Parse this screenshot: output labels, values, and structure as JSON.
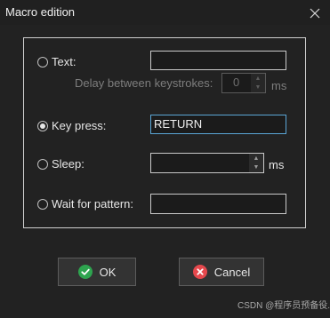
{
  "window": {
    "title": "Macro edition",
    "close_glyph": "✕"
  },
  "options": {
    "text": {
      "label": "Text:",
      "checked": false,
      "value": ""
    },
    "delay": {
      "label": "Delay between keystrokes:",
      "value": "0",
      "unit": "ms",
      "enabled": false
    },
    "key_press": {
      "label": "Key press:",
      "checked": true,
      "value": "RETURN"
    },
    "sleep": {
      "label": "Sleep:",
      "checked": false,
      "value": "",
      "unit": "ms"
    },
    "wait_for_pattern": {
      "label": "Wait for pattern:",
      "checked": false,
      "value": ""
    }
  },
  "buttons": {
    "ok": {
      "label": "OK",
      "icon": "check-icon",
      "color": "#2ea44f"
    },
    "cancel": {
      "label": "Cancel",
      "icon": "cancel-icon",
      "color": "#e5484d"
    }
  },
  "watermark": "CSDN @程序员预备役."
}
